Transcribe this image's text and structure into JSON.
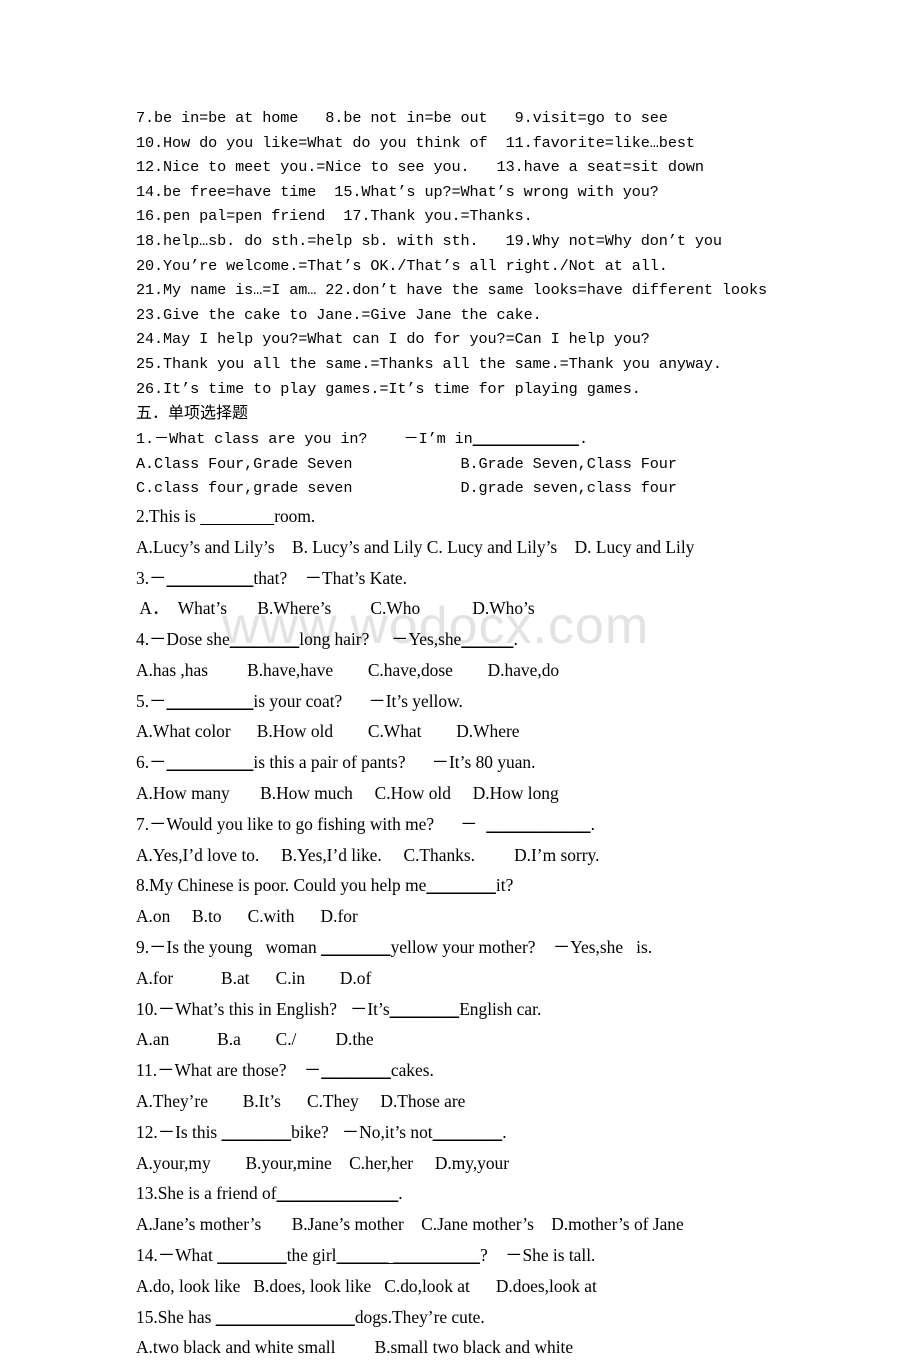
{
  "document": {
    "watermark": "www.wodocx.com",
    "page_background": "#ffffff",
    "text_color": "#000000",
    "watermark_color": "#e3e3e6"
  },
  "synonyms": {
    "lines": [
      "7.be in=be at home   8.be not in=be out   9.visit=go to see",
      "10.How do you like=What do you think of  11.favorite=like…best",
      "12.Nice to meet you.=Nice to see you.   13.have a seat=sit down",
      "14.be free=have time  15.What’s up?=What’s wrong with you?",
      "16.pen pal=pen friend  17.Thank you.=Thanks.",
      "18.help…sb. do sth.=help sb. with sth.   19.Why not=Why don’t you",
      "20.You’re welcome.=That’s OK./That’s all right./Not at all.",
      "21.My name is…=I am… 22.don’t have the same looks=have different looks",
      "23.Give the cake to Jane.=Give Jane the cake.",
      "24.May I help you?=What can I do for you?=Can I help you?",
      "25.Thank you all the same.=Thanks all the same.=Thank you anyway.",
      "26.It’s time to play games.=It’s time for playing games."
    ]
  },
  "section": {
    "heading": "五．单项选择题"
  },
  "questions": [
    {
      "stem_pre": "1.－What class are you in?    －I’m in",
      "stem_blank": "＿＿＿＿＿＿＿",
      "stem_post": ".",
      "options_lines": [
        "A.Class Four,Grade Seven            B.Grade Seven,Class Four",
        "C.class four,grade seven            D.grade seven,class four"
      ]
    },
    {
      "stem_pre": "2.This is ",
      "stem_blank": "                 ",
      "stem_post": "room.",
      "options_lines": [
        "A.Lucy’s and Lily’s    B. Lucy’s and Lily C. Lucy and Lily’s    D. Lucy and Lily"
      ]
    },
    {
      "stem_pre": "3.－",
      "stem_blank": "＿＿＿＿＿",
      "stem_post": "that?    －That’s Kate.",
      "options_lines": [
        " A．  What’s       B.Where’s         C.Who            D.Who’s"
      ]
    },
    {
      "stem_pre": "4.－Dose she",
      "stem_blank": "＿＿＿＿",
      "stem_post": "long hair?     －Yes,she",
      "stem_blank2": "＿＿＿",
      "stem_post2": ".",
      "options_lines": [
        "A.has ,has         B.have,have        C.have,dose        D.have,do"
      ]
    },
    {
      "stem_pre": "5.－",
      "stem_blank": "＿＿＿＿＿",
      "stem_post": "is your coat?      －It’s yellow.",
      "options_lines": [
        "A.What color      B.How old        C.What        D.Where"
      ]
    },
    {
      "stem_pre": "6.－",
      "stem_blank": "＿＿＿＿＿",
      "stem_post": "is this a pair of pants?      －It’s 80 yuan.",
      "options_lines": [
        "A.How many       B.How much     C.How old     D.How long"
      ]
    },
    {
      "stem_pre": "7.－Would you like to go fishing with me?      －  ",
      "stem_blank": "＿＿＿＿＿＿",
      "stem_post": ".",
      "options_lines": [
        "A.Yes,I’d love to.     B.Yes,I’d like.     C.Thanks.         D.I’m sorry."
      ]
    },
    {
      "stem_pre": "8.My Chinese is poor. Could you help me",
      "stem_blank": "＿＿＿＿",
      "stem_post": "it?",
      "options_lines": [
        "A.on     B.to      C.with      D.for"
      ]
    },
    {
      "stem_pre": "9.－Is the young   woman ",
      "stem_blank": "＿＿＿＿",
      "stem_post": "yellow your mother?    －Yes,she   is.",
      "options_lines": [
        "A.for           B.at      C.in        D.of"
      ]
    },
    {
      "stem_pre": "10.－What’s this in English?   －It’s",
      "stem_blank": "＿＿＿＿",
      "stem_post": "English car.",
      "options_lines": [
        "A.an           B.a        C./         D.the"
      ]
    },
    {
      "stem_pre": "11.－What are those?    －",
      "stem_blank": "＿＿＿＿",
      "stem_post": "cakes.",
      "options_lines": [
        "A.They’re        B.It’s      C.They     D.Those are"
      ]
    },
    {
      "stem_pre": "12.－Is this ",
      "stem_blank": "＿＿＿＿",
      "stem_post": "bike?   －No,it’s not",
      "stem_blank2": "＿＿＿＿",
      "stem_post2": ".",
      "options_lines": [
        "A.your,my        B.your,mine    C.her,her     D.my,your"
      ]
    },
    {
      "stem_pre": "13.She is a friend of",
      "stem_blank": "＿＿＿＿＿＿＿",
      "stem_post": ".",
      "options_lines": [
        "A.Jane’s mother’s       B.Jane’s mother    C.Jane mother’s    D.mother’s of Jane"
      ]
    },
    {
      "stem_pre": "14.－What ",
      "stem_blank": "＿＿＿＿",
      "stem_post": "the girl",
      "stem_blank2": "＿＿＿ ＿＿＿＿＿",
      "stem_post2": "?    －She is tall.",
      "options_lines": [
        "A.do, look like   B.does, look like   C.do,look at      D.does,look at"
      ]
    },
    {
      "stem_pre": "15.She has ",
      "stem_blank": "＿＿＿＿＿＿＿＿",
      "stem_post": "dogs.They’re cute.",
      "options_lines": [
        "A.two black and white small         B.small two black and white"
      ]
    }
  ]
}
